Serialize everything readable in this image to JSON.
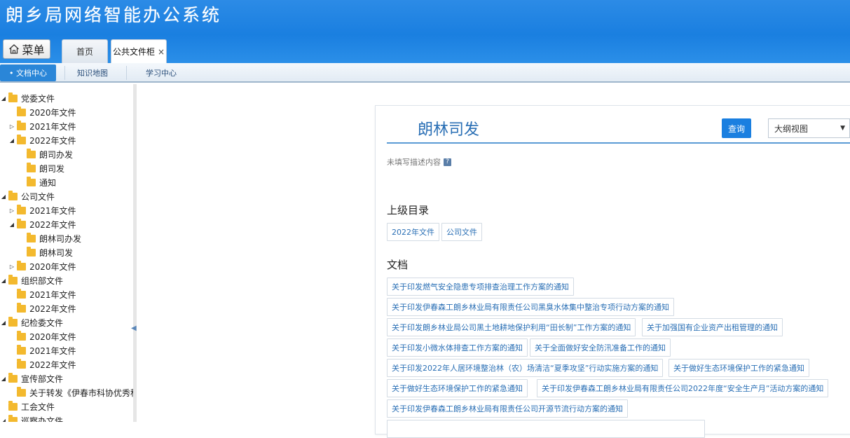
{
  "app": {
    "title": "朗乡局网络智能办公系统"
  },
  "menu": {
    "label": "菜单",
    "icon": "home-icon"
  },
  "tabs": [
    {
      "label": "首页"
    },
    {
      "label": "公共文件柜",
      "close": "×"
    }
  ],
  "subnav": [
    {
      "label": "文档中心"
    },
    {
      "label": "知识地图"
    },
    {
      "label": "学习中心"
    }
  ],
  "tree": [
    {
      "label": "党委文件",
      "toggle": "◢",
      "folder": "folder-icon"
    },
    {
      "label": "2020年文件"
    },
    {
      "label": "2021年文件",
      "toggle": "▷"
    },
    {
      "label": "2022年文件",
      "toggle": "◢"
    },
    {
      "label": "朗司办发"
    },
    {
      "label": "朗司发"
    },
    {
      "label": "通知"
    },
    {
      "label": "公司文件",
      "toggle": "◢"
    },
    {
      "label": "2021年文件",
      "toggle": "▷"
    },
    {
      "label": "2022年文件",
      "toggle": "◢"
    },
    {
      "label": "朗林司办发"
    },
    {
      "label": "朗林司发"
    },
    {
      "label": "2020年文件",
      "toggle": "▷"
    },
    {
      "label": "组织部文件",
      "toggle": "◢"
    },
    {
      "label": "2021年文件"
    },
    {
      "label": "2022年文件"
    },
    {
      "label": "纪检委文件",
      "toggle": "◢"
    },
    {
      "label": "2020年文件"
    },
    {
      "label": "2021年文件"
    },
    {
      "label": "2022年文件"
    },
    {
      "label": "宣传部文件",
      "toggle": "◢"
    },
    {
      "label": "关于转发《伊春市科协优秀科技"
    },
    {
      "label": "工会文件"
    },
    {
      "label": "巡察办文件",
      "toggle": "◢"
    }
  ],
  "main": {
    "title": "朗林司发",
    "query_label": "查询",
    "view_select": "大纲视图",
    "description": "未填写描述内容",
    "parent_heading": "上级目录",
    "parent_tags": [
      "2022年文件",
      "公司文件"
    ],
    "docs_heading": "文档",
    "docs": [
      "关于印发燃气安全隐患专项排查治理工作方案的通知",
      "关于印发伊春森工朗乡林业局有限责任公司黑臭水体集中整治专项行动方案的通知",
      "关于印发朗乡林业局公司黑土地耕地保护利用“田长制”工作方案的通知",
      "关于加强国有企业资产出租管理的通知",
      "关于印发小微水体排查工作方案的通知",
      "关于全面做好安全防汛准备工作的通知",
      "关于印发2022年人居环境整治林（农）场清洁“夏季攻坚”行动实施方案的通知",
      "关于做好生态环境保护工作的紧急通知",
      "关于做好生态环境保护工作的紧急通知",
      "关于印发伊春森工朗乡林业局有限责任公司2022年度“安全生产月”活动方案的通知",
      "关于印发伊春森工朗乡林业局有限责任公司开源节流行动方案的通知"
    ]
  },
  "colors": {
    "brand": "#1a7fe0",
    "link": "#2a6fb5",
    "folder": "#f3b92e"
  }
}
